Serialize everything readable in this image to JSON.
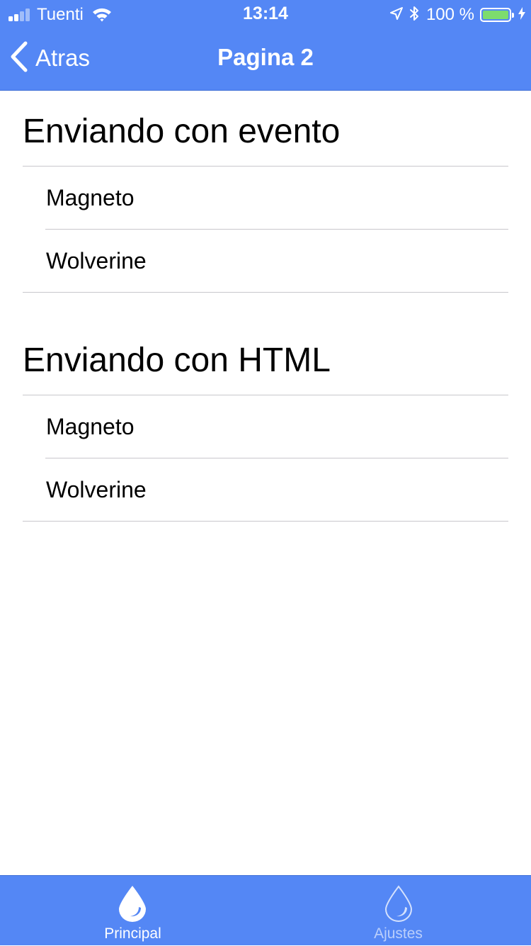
{
  "status_bar": {
    "carrier": "Tuenti",
    "time": "13:14",
    "battery": "100 %",
    "icons": [
      "signal-icon",
      "wifi-icon",
      "location-icon",
      "bluetooth-icon",
      "battery-icon",
      "charging-icon"
    ]
  },
  "nav": {
    "back_label": "Atras",
    "title": "Pagina 2"
  },
  "sections": [
    {
      "title": "Enviando con evento",
      "items": [
        "Magneto",
        "Wolverine"
      ]
    },
    {
      "title": "Enviando con HTML",
      "items": [
        "Magneto",
        "Wolverine"
      ]
    }
  ],
  "tabs": [
    {
      "label": "Principal",
      "icon": "drop-icon",
      "active": true
    },
    {
      "label": "Ajustes",
      "icon": "drop-outline-icon",
      "active": false
    }
  ],
  "colors": {
    "accent": "#5487f5",
    "separator": "#c8c7cc",
    "battery_fill": "#7ddc6d"
  }
}
